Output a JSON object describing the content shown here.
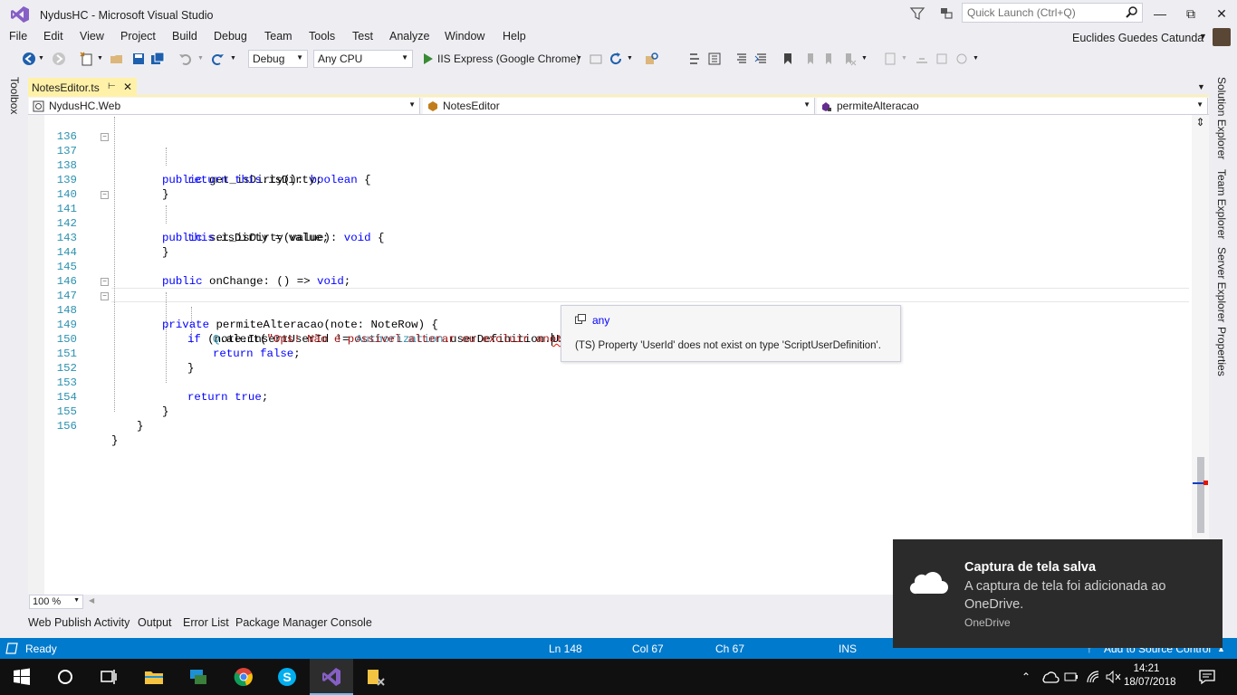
{
  "window": {
    "title": "NydusHC - Microsoft Visual Studio",
    "quick_launch_placeholder": "Quick Launch (Ctrl+Q)",
    "user_name": "Euclides Guedes Catunda"
  },
  "menu": [
    "File",
    "Edit",
    "View",
    "Project",
    "Build",
    "Debug",
    "Team",
    "Tools",
    "Test",
    "Analyze",
    "Window",
    "Help"
  ],
  "toolbar": {
    "configuration": "Debug",
    "platform": "Any CPU",
    "run_target": "IIS Express (Google Chrome)"
  },
  "side_panels": {
    "left": [
      "Toolbox"
    ],
    "right": [
      "Solution Explorer",
      "Team Explorer",
      "Server Explorer",
      "Properties"
    ]
  },
  "document_tab": {
    "label": "NotesEditor.ts"
  },
  "navigation_bar": {
    "project": "NydusHC.Web",
    "type": "NotesEditor",
    "member": "permiteAlteracao"
  },
  "code_lines": [
    {
      "n": "136",
      "t": ""
    },
    {
      "n": "137",
      "t": "public get_isDirty(): boolean {"
    },
    {
      "n": "138",
      "t": "return this.isDirty;"
    },
    {
      "n": "139",
      "t": "}"
    },
    {
      "n": "140",
      "t": ""
    },
    {
      "n": "141",
      "t": "public set_isDirty(value): void {"
    },
    {
      "n": "142",
      "t": "this.isDirty = value;"
    },
    {
      "n": "143",
      "t": "}"
    },
    {
      "n": "144",
      "t": ""
    },
    {
      "n": "145",
      "t": "public onChange: () => void;"
    },
    {
      "n": "146",
      "t": ""
    },
    {
      "n": "147",
      "t": "private permiteAlteracao(note: NoteRow) {"
    },
    {
      "n": "148",
      "t": "if (note.InsertUserId != Authorization.userDefinition.UserId) {"
    },
    {
      "n": "149",
      "t": "Q.alert(\"Ops! Não é possível alterar ou excluir anotaçã"
    },
    {
      "n": "150",
      "t": "return false;"
    },
    {
      "n": "151",
      "t": "}"
    },
    {
      "n": "152",
      "t": ""
    },
    {
      "n": "153",
      "t": "return true;"
    },
    {
      "n": "154",
      "t": "}"
    },
    {
      "n": "155",
      "t": "}"
    },
    {
      "n": "156",
      "t": "}"
    }
  ],
  "tooltip": {
    "type": "any",
    "message": "(TS) Property 'UserId' does not exist on type 'ScriptUserDefinition'."
  },
  "editor": {
    "zoom": "100 %"
  },
  "tool_window_tabs": [
    "Web Publish Activity",
    "Output",
    "Error List",
    "Package Manager Console"
  ],
  "status": {
    "state": "Ready",
    "line": "Ln 148",
    "col": "Col 67",
    "ch": "Ch 67",
    "mode": "INS",
    "source_control": "Add to Source Control"
  },
  "toast": {
    "title": "Captura de tela salva",
    "body": "A captura de tela foi adicionada ao OneDrive.",
    "source": "OneDrive"
  },
  "taskbar": {
    "time": "14:21",
    "date": "18/07/2018"
  },
  "colors": {
    "status_bar": "#007acc",
    "active_tab": "#fff1a8",
    "keyword": "#0000ff",
    "type": "#2b91af",
    "string": "#a31515",
    "error": "#e51400"
  }
}
